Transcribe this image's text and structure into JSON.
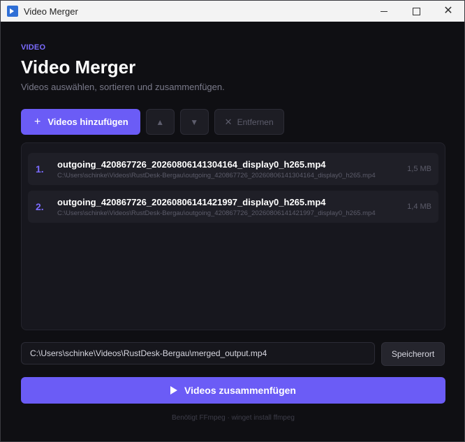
{
  "window": {
    "title": "Video Merger",
    "minimize_icon": "minimize-icon",
    "maximize_icon": "maximize-icon",
    "close_icon": "close-icon",
    "close_glyph": "✕"
  },
  "header": {
    "section_tag": "VIDEO",
    "title": "Video Merger",
    "subtitle": "Videos auswählen, sortieren und zusammenfügen."
  },
  "toolbar": {
    "add_label": "Videos hinzufügen",
    "add_glyph": "+",
    "move_up_glyph": "▲",
    "move_down_glyph": "▼",
    "remove_glyph": "✕",
    "remove_label": "Entfernen"
  },
  "files": [
    {
      "index": "1.",
      "name": "outgoing_420867726_20260806141304164_display0_h265.mp4",
      "path": "C:\\Users\\schinke\\Videos\\RustDesk-Bergau\\outgoing_420867726_20260806141304164_display0_h265.mp4",
      "size": "1,5 MB"
    },
    {
      "index": "2.",
      "name": "outgoing_420867726_20260806141421997_display0_h265.mp4",
      "path": "C:\\Users\\schinke\\Videos\\RustDesk-Bergau\\outgoing_420867726_20260806141421997_display0_h265.mp4",
      "size": "1,4 MB"
    }
  ],
  "output": {
    "path_value": "C:\\Users\\schinke\\Videos\\RustDesk-Bergau\\merged_output.mp4",
    "save_location_label": "Speicherort"
  },
  "merge": {
    "label": "Videos zusammenfügen"
  },
  "footer": {
    "note": "Benötigt FFmpeg · winget install ffmpeg"
  },
  "colors": {
    "accent": "#6b5cf6",
    "accent_text": "#7b6cff",
    "background": "#0f0f13"
  }
}
